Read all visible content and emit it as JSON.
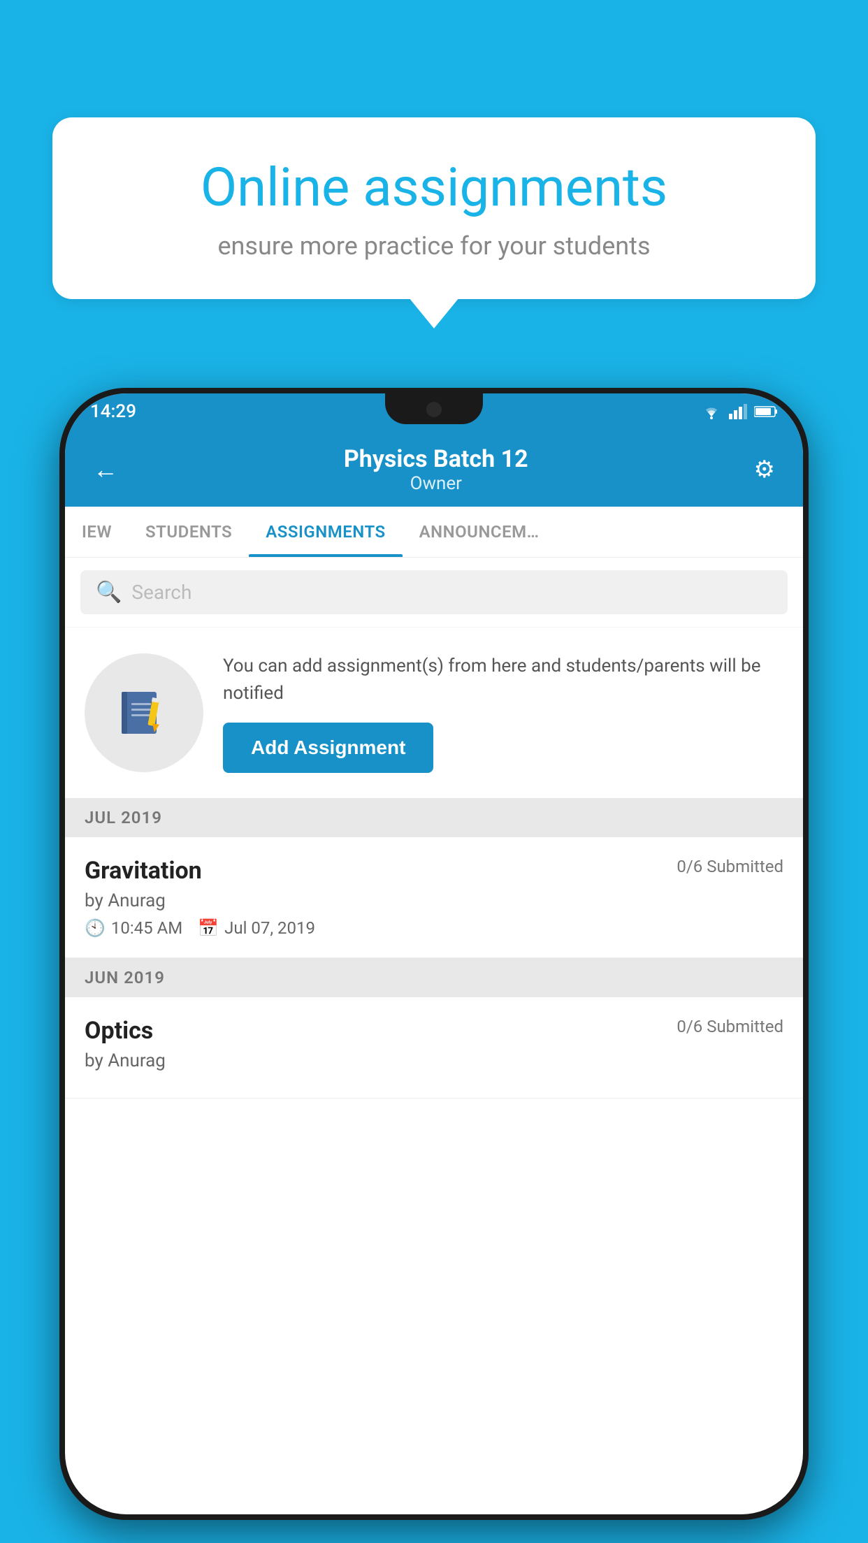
{
  "background_color": "#1ab3e8",
  "speech_bubble": {
    "title": "Online assignments",
    "subtitle": "ensure more practice for your students"
  },
  "status_bar": {
    "time": "14:29"
  },
  "app_header": {
    "title": "Physics Batch 12",
    "subtitle": "Owner",
    "back_label": "←",
    "gear_label": "⚙"
  },
  "tabs": [
    {
      "label": "IEW",
      "active": false
    },
    {
      "label": "STUDENTS",
      "active": false
    },
    {
      "label": "ASSIGNMENTS",
      "active": true
    },
    {
      "label": "ANNOUNCEM…",
      "active": false
    }
  ],
  "search": {
    "placeholder": "Search"
  },
  "promo": {
    "text": "You can add assignment(s) from here and students/parents will be notified",
    "button_label": "Add Assignment"
  },
  "month_groups": [
    {
      "month": "JUL 2019",
      "assignments": [
        {
          "name": "Gravitation",
          "submitted": "0/6 Submitted",
          "by": "by Anurag",
          "time": "10:45 AM",
          "date": "Jul 07, 2019"
        }
      ]
    },
    {
      "month": "JUN 2019",
      "assignments": [
        {
          "name": "Optics",
          "submitted": "0/6 Submitted",
          "by": "by Anurag",
          "time": "",
          "date": ""
        }
      ]
    }
  ]
}
